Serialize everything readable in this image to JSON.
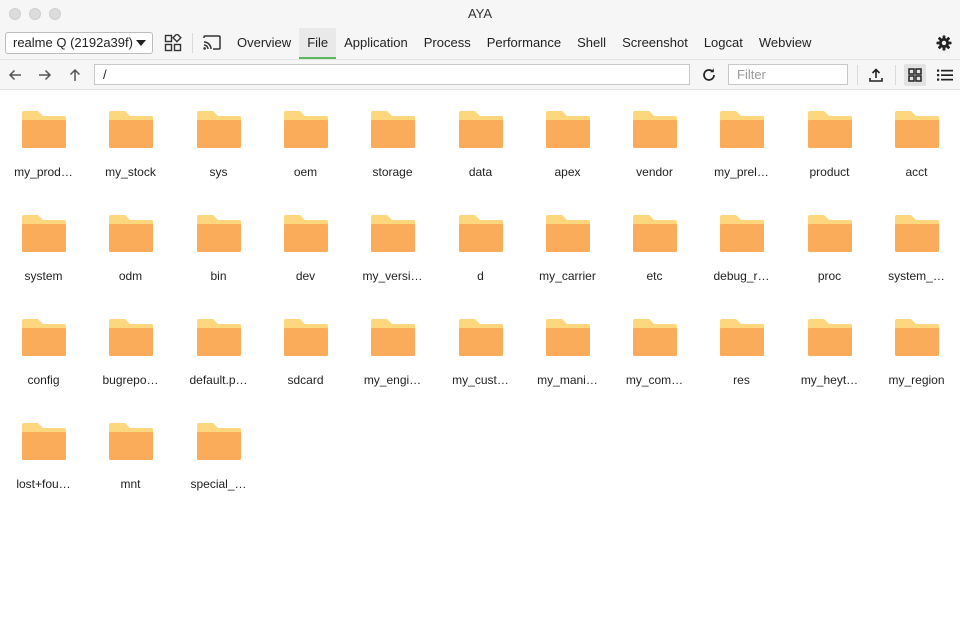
{
  "app": {
    "title": "AYA"
  },
  "device_select": {
    "value": "realme Q (2192a39f)"
  },
  "tabs": [
    {
      "label": "Overview"
    },
    {
      "label": "File",
      "active": true
    },
    {
      "label": "Application"
    },
    {
      "label": "Process"
    },
    {
      "label": "Performance"
    },
    {
      "label": "Shell"
    },
    {
      "label": "Screenshot"
    },
    {
      "label": "Logcat"
    },
    {
      "label": "Webview"
    }
  ],
  "path": {
    "value": "/"
  },
  "filter": {
    "placeholder": "Filter"
  },
  "colors": {
    "folder_front": "#FBAC5A",
    "folder_back": "#FDD77E",
    "active_tab_underline": "#5CB85C"
  },
  "files": [
    "my_prod…",
    "my_stock",
    "sys",
    "oem",
    "storage",
    "data",
    "apex",
    "vendor",
    "my_prel…",
    "product",
    "acct",
    "system",
    "odm",
    "bin",
    "dev",
    "my_versi…",
    "d",
    "my_carrier",
    "etc",
    "debug_r…",
    "proc",
    "system_…",
    "config",
    "bugrepo…",
    "default.p…",
    "sdcard",
    "my_engi…",
    "my_cust…",
    "my_mani…",
    "my_com…",
    "res",
    "my_heyt…",
    "my_region",
    "lost+fou…",
    "mnt",
    "special_…"
  ]
}
